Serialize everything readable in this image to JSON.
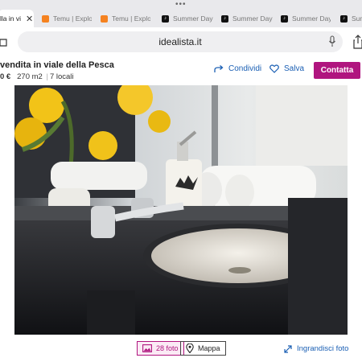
{
  "browser": {
    "menu_dots": "•••",
    "tabs": [
      {
        "label": "lla in vi",
        "icon": "close-icon",
        "active": true
      },
      {
        "label": "Temu | Explo",
        "icon": "temu-favicon"
      },
      {
        "label": "Temu | Explo",
        "icon": "temu-favicon"
      },
      {
        "label": "Summer Day",
        "icon": "tiktok-favicon"
      },
      {
        "label": "Summer Day",
        "icon": "tiktok-favicon"
      },
      {
        "label": "Summer Day",
        "icon": "tiktok-favicon"
      },
      {
        "label": "Summer Da",
        "icon": "tiktok-favicon"
      }
    ],
    "close_glyph": "✕",
    "url": "idealista.it"
  },
  "listing": {
    "title": "vendita in viale della Pesca",
    "price": "0 €",
    "area": "270 m2",
    "rooms": "7 locali",
    "separator": "|",
    "actions": {
      "share_label": "Condividi",
      "save_label": "Salva",
      "contact_label": "Contatta"
    },
    "colors": {
      "accent": "#b0157f",
      "link": "#1a5fb4"
    }
  },
  "gallery": {
    "photos_label": "28 foto",
    "map_label": "Mappa",
    "enlarge_label": "Ingrandisci foto"
  }
}
